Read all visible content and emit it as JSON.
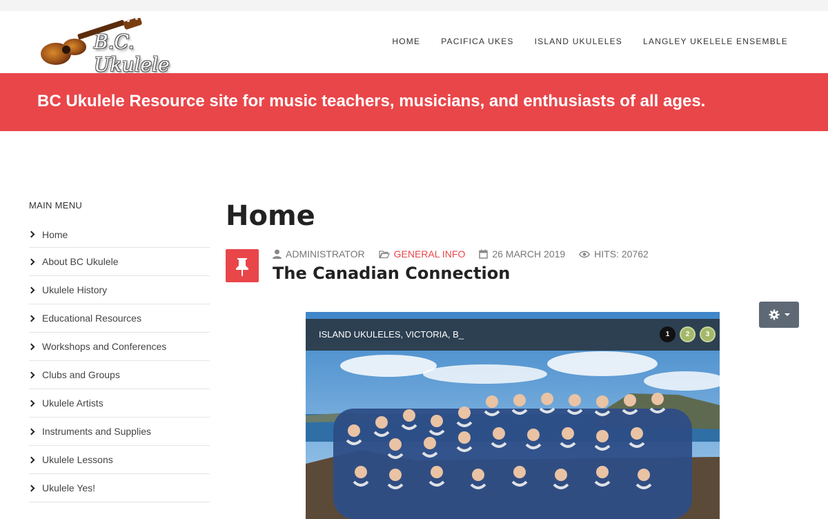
{
  "header": {
    "logo_text": "B.C. Ukulele",
    "nav": [
      "HOME",
      "PACIFICA UKES",
      "ISLAND UKULELES",
      "LANGLEY UKELELE ENSEMBLE"
    ]
  },
  "banner": {
    "text": "BC Ukulele Resource site for music teachers, musicians, and enthusiasts of all ages."
  },
  "sidebar": {
    "title": "MAIN MENU",
    "items": [
      "Home",
      "About BC Ukulele",
      "Ukulele History",
      "Educational Resources",
      "Workshops and Conferences",
      "Clubs and Groups",
      "Ukulele Artists",
      "Instruments and Supplies",
      "Ukulele Lessons",
      "Ukulele Yes!"
    ]
  },
  "main": {
    "page_title": "Home",
    "meta": {
      "author": "ADMINISTRATOR",
      "category": "GENERAL INFO",
      "date": "26 MARCH 2019",
      "hits": "HITS: 20762"
    },
    "article_title": "The Canadian Connection",
    "slideshow": {
      "caption": "ISLAND UKULELES, VICTORIA, B_",
      "pages": [
        "1",
        "2",
        "3"
      ],
      "active_page": 1
    }
  },
  "colors": {
    "accent": "#e9464a",
    "button_gray": "#5e6975",
    "dot_green": "#a3b86a"
  }
}
